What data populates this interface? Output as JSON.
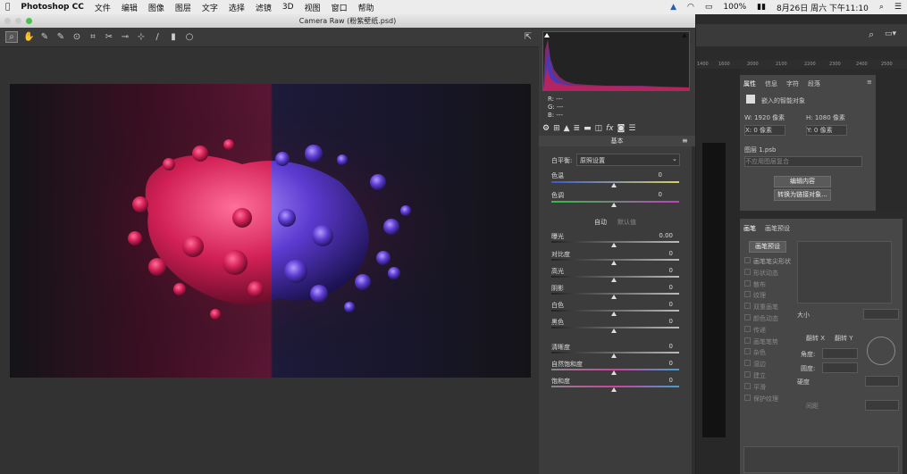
{
  "menubar": {
    "apple": "",
    "app": "Photoshop CC",
    "items": [
      "文件",
      "编辑",
      "图像",
      "图层",
      "文字",
      "选择",
      "滤镜",
      "3D",
      "视图",
      "窗口",
      "帮助"
    ],
    "battery": "100%",
    "clock": "8月26日 周六 下午11:10"
  },
  "cameraraw": {
    "title": "Camera Raw (粉紫壁纸.psd)",
    "rgb": {
      "r": "R:  ---",
      "g": "G:  ---",
      "b": "B:  ---"
    },
    "panel_title": "基本",
    "white_balance_label": "白平衡:",
    "white_balance_value": "原照设置",
    "temp_label": "色温",
    "temp_value": "0",
    "tint_label": "色调",
    "tint_value": "0",
    "auto_label": "自动",
    "default_label": "默认值",
    "sliders": [
      {
        "label": "曝光",
        "value": "0.00"
      },
      {
        "label": "对比度",
        "value": "0"
      },
      {
        "label": "高光",
        "value": "0"
      },
      {
        "label": "阴影",
        "value": "0"
      },
      {
        "label": "白色",
        "value": "0"
      },
      {
        "label": "黑色",
        "value": "0"
      },
      {
        "label": "清晰度",
        "value": "0"
      },
      {
        "label": "自然饱和度",
        "value": "0"
      },
      {
        "label": "饱和度",
        "value": "0"
      }
    ]
  },
  "ps": {
    "ruler": [
      "1400",
      "1600",
      "2000",
      "2100",
      "2200",
      "2300",
      "2400",
      "2500"
    ],
    "props_tabs": [
      "属性",
      "信息",
      "字符",
      "段落"
    ],
    "smart_object": "嵌入的智能对象",
    "w": "W: 1920 像素",
    "h": "H: 1080 像素",
    "x": "X: 0 像素",
    "y": "Y: 0 像素",
    "layer_file": "图层 1.psb",
    "layer_comp": "不应用图层复合",
    "edit_btn": "编辑内容",
    "convert_btn": "转换为链接对象...",
    "brush_tabs": [
      "画笔",
      "画笔预设"
    ],
    "brush_preset_btn": "画笔预设",
    "brush_options": [
      "画笔笔尖形状",
      "形状动态",
      "散布",
      "纹理",
      "双重画笔",
      "颜色动态",
      "传递",
      "画笔笔势",
      "杂色",
      "湿边",
      "建立",
      "平滑",
      "保护纹理"
    ],
    "size_label": "大小",
    "flip_x": "翻转 X",
    "flip_y": "翻转 Y",
    "angle_label": "角度:",
    "roundness_label": "圆度:",
    "hardness_label": "硬度",
    "spacing_label": "间距"
  },
  "colors": {
    "accent_pink": "#d0204a",
    "accent_blue": "#3a2a9a"
  }
}
